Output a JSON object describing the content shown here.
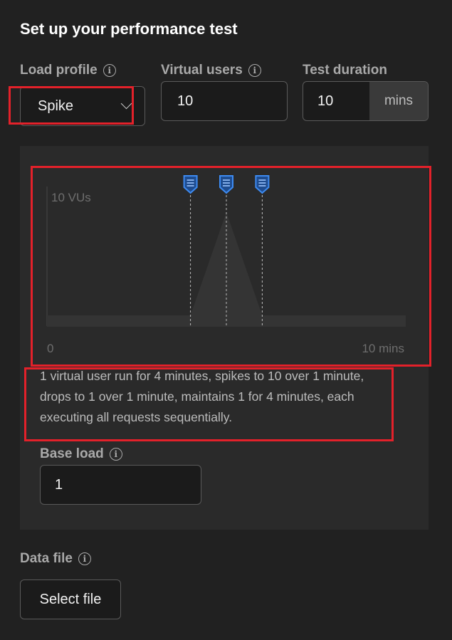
{
  "title": "Set up your performance test",
  "load_profile": {
    "label": "Load profile",
    "value": "Spike"
  },
  "virtual_users": {
    "label": "Virtual users",
    "value": "10"
  },
  "test_duration": {
    "label": "Test duration",
    "value": "10",
    "unit": "mins"
  },
  "chart": {
    "y_max_label": "10 VUs",
    "x_start_label": "0",
    "x_end_label": "10 mins",
    "marker_icon": "request-marker-icon"
  },
  "chart_data": {
    "type": "area",
    "x": [
      0,
      4,
      5,
      6,
      10
    ],
    "values": [
      1,
      1,
      10,
      1,
      1
    ],
    "xlim": [
      0,
      10
    ],
    "ylim": [
      0,
      10
    ],
    "ylabel": "10 VUs",
    "xticks": [
      "0",
      "10 mins"
    ],
    "markers_at_minutes": [
      4,
      5,
      6
    ]
  },
  "description": "1 virtual user run for 4 minutes, spikes to 10 over 1 minute, drops to 1 over 1 minute, maintains 1 for 4 minutes, each executing all requests sequentially.",
  "base_load": {
    "label": "Base load",
    "value": "1"
  },
  "data_file": {
    "label": "Data file",
    "button_label": "Select file"
  },
  "colors": {
    "highlight": "#e3212a",
    "marker": "#3d8bf2"
  }
}
